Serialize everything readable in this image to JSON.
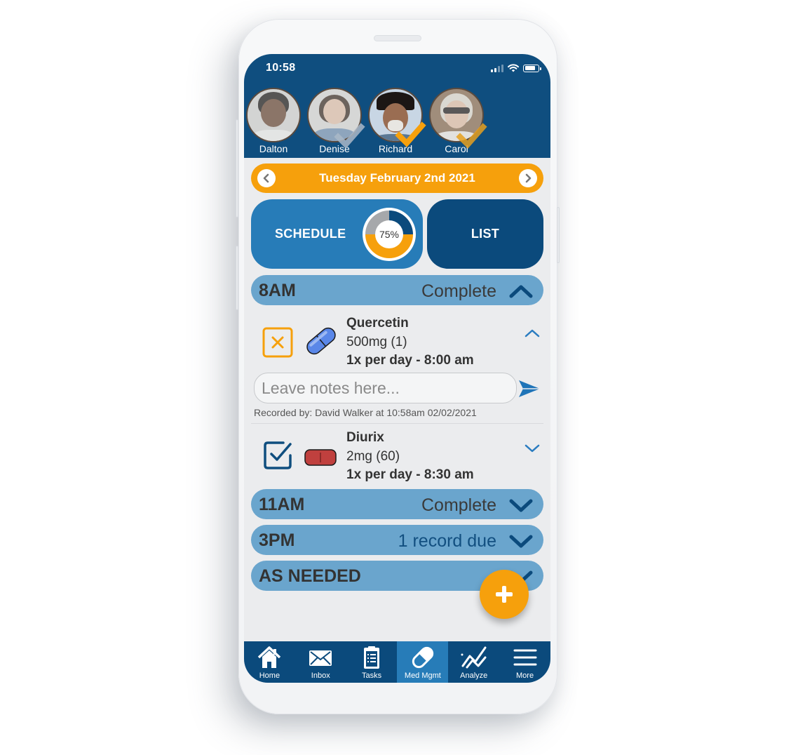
{
  "status_bar": {
    "time": "10:58",
    "icons": [
      "signal-icon",
      "wifi-icon",
      "battery-icon"
    ]
  },
  "profiles": [
    {
      "name": "Dalton",
      "selected": false,
      "check": "none"
    },
    {
      "name": "Denise",
      "selected": false,
      "check": "grey"
    },
    {
      "name": "Richard",
      "selected": true,
      "check": "orange"
    },
    {
      "name": "Carol",
      "selected": false,
      "check": "orange"
    }
  ],
  "date_nav": {
    "label": "Tuesday February 2nd 2021",
    "prev_icon": "chevron-left-icon",
    "next_icon": "chevron-right-icon"
  },
  "view_toggle": {
    "schedule_label": "SCHEDULE",
    "list_label": "LIST",
    "progress_label": "75%",
    "progress": {
      "complete": 0.25,
      "pending": 0.25,
      "remaining": 0.5
    },
    "colors": {
      "complete": "#0b4a7c",
      "pending": "#a6a8ab",
      "remaining": "#f6a00c"
    }
  },
  "sections": [
    {
      "time": "8AM",
      "status": "Complete",
      "expanded": true,
      "meds": [
        {
          "name": "Quercetin",
          "dose": "500mg (1)",
          "frequency": "1x per day - 8:00 am",
          "state": "skipped",
          "pill": "blue-capsule",
          "expanded": true,
          "notes_placeholder": "Leave notes here...",
          "notes_value": "",
          "recorded": "Recorded by: David Walker at 10:58am  02/02/2021"
        },
        {
          "name": "Diurix",
          "dose": "2mg (60)",
          "frequency": "1x per day - 8:30 am",
          "state": "taken",
          "pill": "red-tablet",
          "expanded": false
        }
      ]
    },
    {
      "time": "11AM",
      "status": "Complete",
      "expanded": false
    },
    {
      "time": "3PM",
      "status": "1 record due",
      "expanded": false
    },
    {
      "time": "AS NEEDED",
      "status": "",
      "expanded": false
    }
  ],
  "fab": {
    "icon": "plus-icon"
  },
  "tabbar": [
    {
      "label": "Home",
      "icon": "home-icon",
      "active": false
    },
    {
      "label": "Inbox",
      "icon": "envelope-icon",
      "active": false
    },
    {
      "label": "Tasks",
      "icon": "clipboard-icon",
      "active": false
    },
    {
      "label": "Med Mgmt",
      "icon": "pill-icon",
      "active": true
    },
    {
      "label": "Analyze",
      "icon": "chart-line-icon",
      "active": false
    },
    {
      "label": "More",
      "icon": "menu-icon",
      "active": false
    }
  ],
  "colors": {
    "header": "#0f4e7f",
    "accent_orange": "#f6a00c",
    "section_bar": "#6aa5cd",
    "schedule_active": "#277cb8",
    "list_dark": "#0b4a7c"
  }
}
